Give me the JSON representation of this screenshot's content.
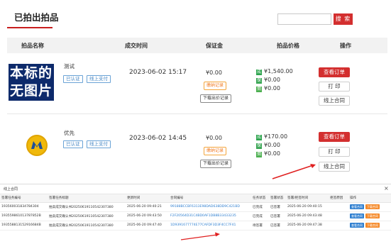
{
  "page": {
    "title": "已拍出拍品",
    "search": {
      "placeholder": "",
      "button": "搜 索"
    }
  },
  "table": {
    "headers": {
      "name": "拍品名称",
      "time": "成交时间",
      "deposit": "保证金",
      "price": "拍品价格",
      "ops": "操作"
    },
    "rows": [
      {
        "image_text": [
          "本标的",
          "无图片"
        ],
        "name": "测试",
        "tags": [
          "已认证",
          "线上支付"
        ],
        "time": "2023-06-02 15:17",
        "deposit": "¥0.00",
        "deposit_btn1": "缴纳记录",
        "deposit_btn2": "下载出价记录",
        "price_lines": [
          {
            "badge": "成",
            "value": "¥1,540.00"
          },
          {
            "badge": "保",
            "value": "¥0.00"
          },
          {
            "badge": "佣",
            "value": "¥0.00"
          }
        ],
        "ops": [
          "查看订单",
          "打 印",
          "线上合同"
        ]
      },
      {
        "name": "优先",
        "tags": [
          "已认证",
          "线上支付"
        ],
        "time": "2023-06-02 14:45",
        "deposit": "¥0.00",
        "deposit_btn1": "缴纳记录",
        "deposit_btn2": "下载出价记录",
        "price_lines": [
          {
            "badge": "成",
            "value": "¥170.00"
          },
          {
            "badge": "保",
            "value": "¥0.00"
          },
          {
            "badge": "佣",
            "value": "¥0.00"
          }
        ],
        "ops": [
          "查看订单",
          "打 印",
          "线上合同"
        ]
      }
    ]
  },
  "contract_modal": {
    "title": "线上合同",
    "close": "×",
    "headers": [
      "签署任务编号",
      "签署任务标题",
      "更新时间",
      "合同编号",
      "任务状态",
      "签署状态",
      "签署/拒签时间",
      "拒签原因",
      "操作"
    ],
    "rows": [
      [
        "193560031834784304",
        "拍卖成交确认书20250619110542307380",
        "2025-06-20 09:40:21",
        "99188BCCBF6313E98DAD638DD9C421BD",
        "已完成",
        "已签署",
        "2025-06-20 09:40:15",
        "",
        "",
        ""
      ],
      [
        "193559861013787852B",
        "拍卖成交确认书20250619110542307380",
        "2025-06-20 09:43:50",
        "F2F20564D31C4BD0AF1DB8B33433235",
        "已完成",
        "已签署",
        "2025-06-20 09:43:48",
        "",
        "",
        ""
      ],
      [
        "193558813152916684B",
        "拍卖成交确认书20250619110542307380",
        "2025-06-20 09:47:40",
        "1D9391677774E77CAFDF3D3F4CC7F41",
        "待签署",
        "已签署",
        "2025-06-20 09:47:38",
        "",
        "",
        ""
      ]
    ],
    "row_ops": [
      "查看合同",
      "下载合同"
    ]
  },
  "colors": {
    "accent": "#d32f2f",
    "link": "#2f7fd0",
    "tag": "#4a8ac6",
    "badge_green": "#2da44e",
    "orange": "#f58a2a"
  }
}
